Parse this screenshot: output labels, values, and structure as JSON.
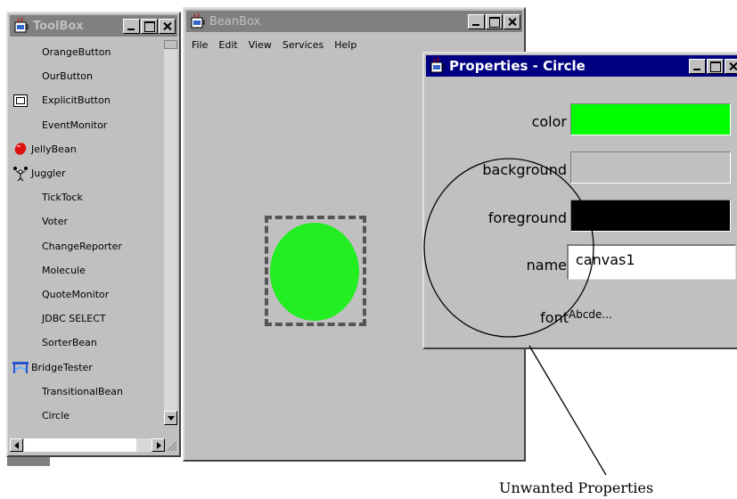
{
  "toolbox": {
    "title": "ToolBox",
    "items": [
      {
        "label": "OrangeButton",
        "icon": ""
      },
      {
        "label": "OurButton",
        "icon": ""
      },
      {
        "label": "ExplicitButton",
        "icon": "button-square-icon"
      },
      {
        "label": "EventMonitor",
        "icon": ""
      },
      {
        "label": "JellyBean",
        "icon": "red-jellybean-icon"
      },
      {
        "label": "Juggler",
        "icon": "juggler-icon"
      },
      {
        "label": "TickTock",
        "icon": ""
      },
      {
        "label": "Voter",
        "icon": ""
      },
      {
        "label": "ChangeReporter",
        "icon": ""
      },
      {
        "label": "Molecule",
        "icon": ""
      },
      {
        "label": "QuoteMonitor",
        "icon": ""
      },
      {
        "label": "JDBC SELECT",
        "icon": ""
      },
      {
        "label": "SorterBean",
        "icon": ""
      },
      {
        "label": "BridgeTester",
        "icon": "bridge-icon"
      },
      {
        "label": "TransitionalBean",
        "icon": ""
      },
      {
        "label": "Circle",
        "icon": ""
      }
    ]
  },
  "beanbox": {
    "title": "BeanBox",
    "menu": [
      "File",
      "Edit",
      "View",
      "Services",
      "Help"
    ],
    "bean_color": "#22ee22"
  },
  "properties": {
    "title": "Properties - Circle",
    "color_label": "color",
    "color_value": "#00ff00",
    "background_label": "background",
    "background_value": "#c0c0c0",
    "foreground_label": "foreground",
    "foreground_value": "#000000",
    "name_label": "name",
    "name_value": "canvas1",
    "font_label": "font",
    "font_value": "Abcde..."
  },
  "annotation": {
    "label": "Unwanted Properties"
  }
}
